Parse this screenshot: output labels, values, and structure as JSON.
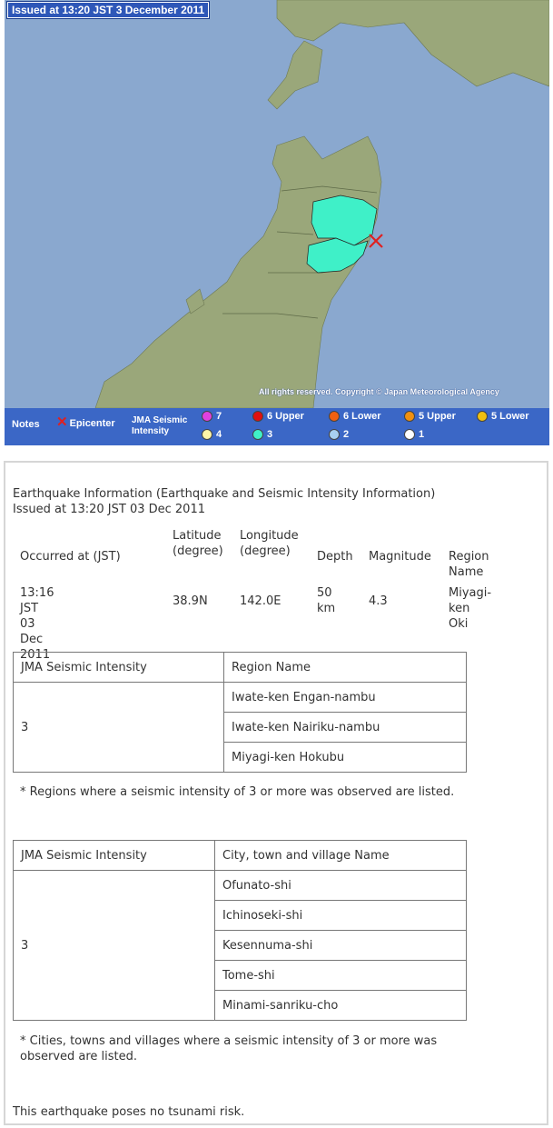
{
  "map": {
    "issued_label": "Issued at 13:20 JST  3 December 2011",
    "copyright": "All rights reserved. Copyright © Japan Meteorological Agency",
    "colors": {
      "sea": "#8aa8cf",
      "land": "#9aa77a",
      "intensity3": "#3ff0c8",
      "epicenter": "#e02020"
    },
    "legend": {
      "notes_label": "Notes",
      "epicenter_label": "Epicenter",
      "jma_label_line1": "JMA Seismic",
      "jma_label_line2": "Intensity",
      "items": [
        {
          "label": "7",
          "color": "#e040e0"
        },
        {
          "label": "6 Upper",
          "color": "#e01010"
        },
        {
          "label": "6 Lower",
          "color": "#f06010"
        },
        {
          "label": "5 Upper",
          "color": "#f09010"
        },
        {
          "label": "5 Lower",
          "color": "#f0c010"
        },
        {
          "label": "4",
          "color": "#fff5a8"
        },
        {
          "label": "3",
          "color": "#3ff0c8"
        },
        {
          "label": "2",
          "color": "#a8d0f0"
        },
        {
          "label": "1",
          "color": "#ffffff"
        }
      ]
    }
  },
  "info": {
    "title": "Earthquake Information (Earthquake and Seismic Intensity Information)",
    "issued": "Issued at 13:20 JST 03 Dec 2011",
    "headers": {
      "occurred": "Occurred at (JST)",
      "lat1": "Latitude",
      "lat2": "(degree)",
      "lon1": "Longitude",
      "lon2": "(degree)",
      "depth": "Depth",
      "magnitude": "Magnitude",
      "region": "Region Name"
    },
    "values": {
      "occurred1": "13:16 JST 03 Dec",
      "occurred2": "2011",
      "latitude": "38.9N",
      "longitude": "142.0E",
      "depth1": "50",
      "depth2": "km",
      "magnitude": "4.3",
      "region1": "Miyagi-ken",
      "region2": "Oki"
    },
    "region_table": {
      "col1": "JMA Seismic Intensity",
      "col2": "Region Name",
      "intensity": "3",
      "rows": [
        "Iwate-ken Engan-nambu",
        "Iwate-ken Nairiku-nambu",
        "Miyagi-ken Hokubu"
      ]
    },
    "region_note": "* Regions where a seismic intensity of 3 or more was observed are listed.",
    "city_table": {
      "col1": "JMA Seismic Intensity",
      "col2": "City, town and village Name",
      "intensity": "3",
      "rows": [
        "Ofunato-shi",
        "Ichinoseki-shi",
        "Kesennuma-shi",
        "Tome-shi",
        "Minami-sanriku-cho"
      ]
    },
    "city_note1": "* Cities, towns and villages where a seismic intensity of 3 or more was",
    "city_note2": "observed are listed.",
    "tsunami": "This earthquake poses no tsunami risk."
  }
}
